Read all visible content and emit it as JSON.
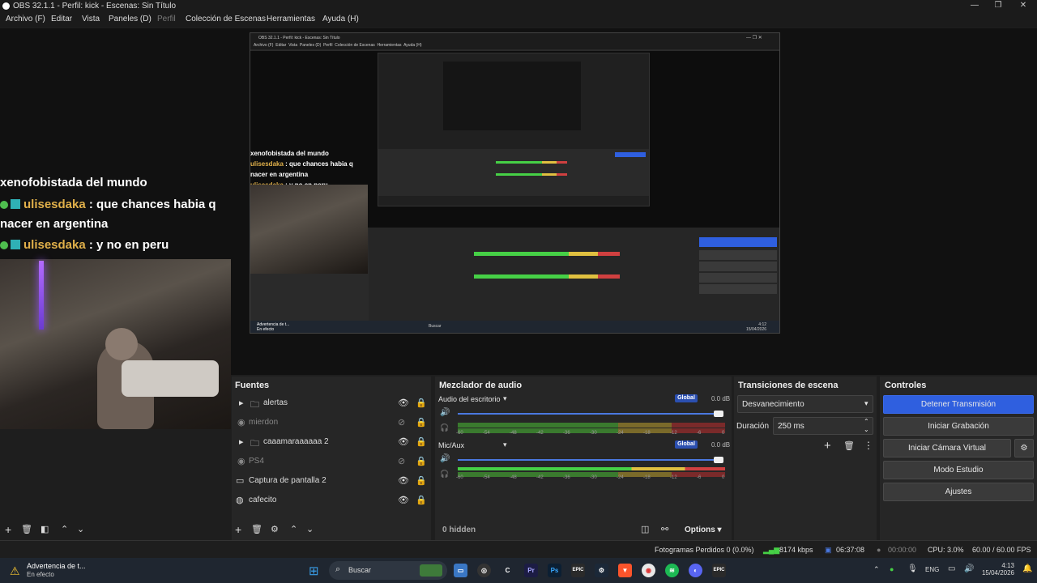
{
  "window": {
    "title": "OBS 32.1.1 - Perfil: kick - Escenas: Sin Título"
  },
  "menu": [
    "Archivo (F)",
    "Editar",
    "Vista",
    "Paneles (D)",
    "Perfil",
    "Colección de Escenas",
    "Herramientas",
    "Ayuda (H)"
  ],
  "preview": {
    "chat": [
      {
        "user": "",
        "text": "xenofobistada del mundo"
      },
      {
        "user": "ulisesdaka",
        "text": ": que chances habia q"
      },
      {
        "user": "",
        "text": "nacer en argentina"
      },
      {
        "user": "ulisesdaka",
        "text": ": y no en peru"
      }
    ],
    "nested_title": "OBS 32.1.1 - Perfil: kick - Escenas: Sin Título",
    "nested_menu": [
      "Archivo (F)",
      "Editar",
      "Vista",
      "Paneles (D)",
      "Perfil",
      "Colección de Escenas",
      "Herramientas",
      "Ayuda (H)"
    ],
    "nested_taskbar_warning": "Advertencia de t...",
    "nested_taskbar_warning_sub": "En efecto",
    "nested_search": "Buscar",
    "nested_time": "4:12",
    "nested_date": "15/04/2026"
  },
  "sources": {
    "title": "Fuentes",
    "items": [
      {
        "name": "alertas",
        "type": "folder",
        "dim": false
      },
      {
        "name": "mierdon",
        "type": "camera",
        "dim": true
      },
      {
        "name": "caaamaraaaaaa 2",
        "type": "folder",
        "dim": false
      },
      {
        "name": "PS4",
        "type": "camera",
        "dim": true
      },
      {
        "name": "Captura de pantalla 2",
        "type": "monitor",
        "dim": false
      },
      {
        "name": "cafecito",
        "type": "globe",
        "dim": false
      }
    ]
  },
  "mixer": {
    "title": "Mezclador de audio",
    "channels": [
      {
        "name": "Audio del escritorio",
        "tag": "Global",
        "db": "0.0 dB"
      },
      {
        "name": "Mic/Aux",
        "tag": "Global",
        "db": "0.0 dB"
      }
    ],
    "ticks": [
      "-60",
      "-54",
      "-48",
      "-42",
      "-36",
      "-30",
      "-24",
      "-18",
      "-12",
      "-6",
      "0"
    ],
    "hidden": "0 hidden",
    "options": "Options"
  },
  "transitions": {
    "title": "Transiciones de escena",
    "selected": "Desvanecimiento",
    "duration_label": "Duración",
    "duration_value": "250 ms"
  },
  "controls": {
    "title": "Controles",
    "stop_stream": "Detener Transmisión",
    "start_record": "Iniciar Grabación",
    "virtual_cam": "Iniciar Cámara Virtual",
    "studio_mode": "Modo Estudio",
    "settings": "Ajustes"
  },
  "status": {
    "dropped": "Fotogramas Perdidos 0 (0.0%)",
    "bitrate": "8174 kbps",
    "stream_time": "06:37:08",
    "rec_time": "00:00:00",
    "cpu": "CPU: 3.0%",
    "fps": "60.00 / 60.00 FPS"
  },
  "taskbar": {
    "warning_title": "Advertencia de t...",
    "warning_sub": "En efecto",
    "search": "Buscar",
    "lang": "ENG",
    "time": "4:13",
    "date": "15/04/2026"
  },
  "colors": {
    "accent": "#2f5fdf",
    "chat_user": "#e0b04a",
    "led": "#9a55ff"
  }
}
